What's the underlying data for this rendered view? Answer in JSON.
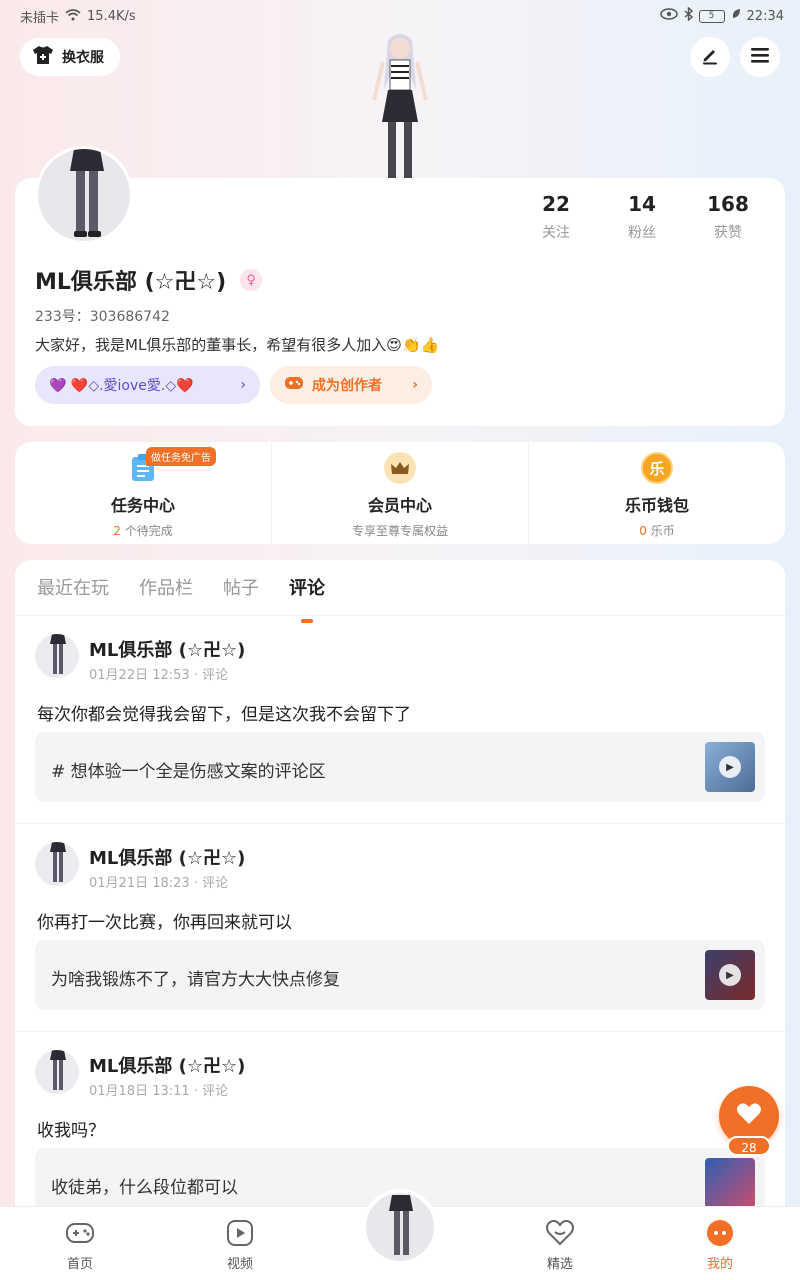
{
  "status_bar": {
    "left_text": "未插卡",
    "speed": "15.4K/s",
    "battery": "5",
    "time": "22:34"
  },
  "header": {
    "wardrobe_label": "换衣服",
    "edit_icon": "pencil-icon",
    "menu_icon": "menu-icon"
  },
  "profile": {
    "stats": [
      {
        "value": "22",
        "label": "关注"
      },
      {
        "value": "14",
        "label": "粉丝"
      },
      {
        "value": "168",
        "label": "获赞"
      }
    ],
    "username": "ML俱乐部 (☆卍☆)",
    "gender_symbol": "♀",
    "uid": "233号：303686742",
    "bio": "大家好，我是ML俱乐部的董事长，希望有很多人加入😍👏👍",
    "medal_pill": "💜 ❤️◇.愛iove愛.◇❤️",
    "creator_pill": "成为创作者"
  },
  "features": [
    {
      "title": "任务中心",
      "sub_highlight": "2",
      "sub_text": " 个待完成",
      "badge": "做任务免广告",
      "icon": "clipboard-icon",
      "color": "#3fa7f0"
    },
    {
      "title": "会员中心",
      "sub_highlight": "",
      "sub_text": "专享至尊专属权益",
      "badge": "",
      "icon": "crown-icon",
      "color": "#e8a93a"
    },
    {
      "title": "乐币钱包",
      "sub_highlight": "0",
      "sub_text": " 乐币",
      "badge": "",
      "icon": "coin-icon",
      "color": "#f5a623"
    }
  ],
  "tabs": [
    "最近在玩",
    "作品栏",
    "帖子",
    "评论"
  ],
  "active_tab": "评论",
  "posts": [
    {
      "author": "ML俱乐部 (☆卍☆)",
      "meta": "01月22日 12:53 · 评论",
      "text": "每次你都会觉得我会留下，但是这次我不会留下了",
      "ref": "# 想体验一个全是伤感文案的评论区"
    },
    {
      "author": "ML俱乐部 (☆卍☆)",
      "meta": "01月21日 18:23 · 评论",
      "text": "你再打一次比赛，你再回来就可以",
      "ref": "为啥我锻炼不了，请官方大大快点修复"
    },
    {
      "author": "ML俱乐部 (☆卍☆)",
      "meta": "01月18日 13:11 · 评论",
      "text": "收我吗？",
      "ref": "收徒弟，什么段位都可以"
    }
  ],
  "like_count": "28",
  "bottom_nav": [
    {
      "label": "首页",
      "icon": "gamepad-icon"
    },
    {
      "label": "视频",
      "icon": "play-icon"
    },
    {
      "label": "精选",
      "icon": "heart-icon"
    },
    {
      "label": "我的",
      "icon": "face-icon"
    }
  ],
  "colors": {
    "accent": "#f07028",
    "medal_purple": "#5a4fcf"
  }
}
